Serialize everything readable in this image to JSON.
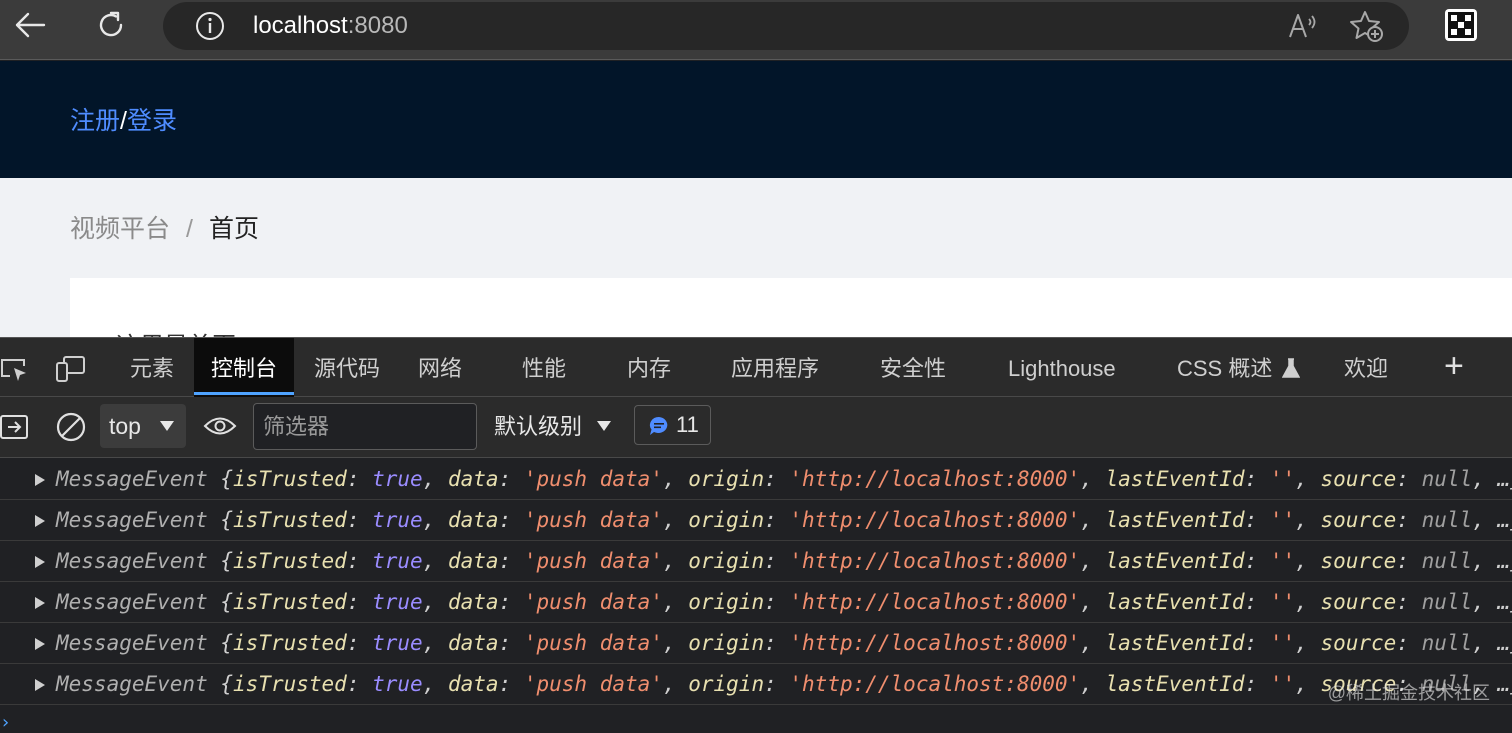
{
  "browser": {
    "url_host": "localhost",
    "url_port": ":8080"
  },
  "page": {
    "header": {
      "register_link": "注册",
      "separator": "/",
      "login_link": "登录"
    },
    "breadcrumb": [
      {
        "label": "视频平台"
      },
      {
        "label": "/"
      },
      {
        "label": "首页"
      }
    ],
    "card_text": "这里是首页"
  },
  "devtools": {
    "tabs": [
      {
        "label": "元素"
      },
      {
        "label": "控制台"
      },
      {
        "label": "源代码"
      },
      {
        "label": "网络"
      },
      {
        "label": "性能"
      },
      {
        "label": "内存"
      },
      {
        "label": "应用程序"
      },
      {
        "label": "安全性"
      },
      {
        "label": "Lighthouse"
      },
      {
        "label": "CSS 概述"
      },
      {
        "label": "欢迎"
      }
    ],
    "active_tab": "控制台",
    "add_tab_label": "+",
    "toolbar": {
      "context": "top",
      "filter_placeholder": "筛选器",
      "level": "默认级别",
      "issue_count": "11"
    },
    "log_entries": [
      {
        "type": "MessageEvent",
        "isTrusted": "true",
        "data": "'push data'",
        "origin": "'http://localhost:8000'",
        "lastEventId": "''",
        "source": "null",
        "more": "…}"
      },
      {
        "type": "MessageEvent",
        "isTrusted": "true",
        "data": "'push data'",
        "origin": "'http://localhost:8000'",
        "lastEventId": "''",
        "source": "null",
        "more": "…}"
      },
      {
        "type": "MessageEvent",
        "isTrusted": "true",
        "data": "'push data'",
        "origin": "'http://localhost:8000'",
        "lastEventId": "''",
        "source": "null",
        "more": "…}"
      },
      {
        "type": "MessageEvent",
        "isTrusted": "true",
        "data": "'push data'",
        "origin": "'http://localhost:8000'",
        "lastEventId": "''",
        "source": "null",
        "more": "…}"
      },
      {
        "type": "MessageEvent",
        "isTrusted": "true",
        "data": "'push data'",
        "origin": "'http://localhost:8000'",
        "lastEventId": "''",
        "source": "null",
        "more": "…}"
      },
      {
        "type": "MessageEvent",
        "isTrusted": "true",
        "data": "'push data'",
        "origin": "'http://localhost:8000'",
        "lastEventId": "''",
        "source": "null",
        "more": "…}"
      }
    ],
    "prompt": "›"
  },
  "watermark": "@稀土掘金技术社区",
  "colors": {
    "accent": "#4fa3ff",
    "link": "#4f8cff",
    "header_bg": "#021529",
    "string_value": "#f08e6e",
    "boolean_value": "#9a8cff"
  },
  "icons": [
    "back-arrow-icon",
    "reload-icon",
    "info-icon",
    "read-aloud-icon",
    "favorite-add-icon",
    "extension-icon",
    "inspect-element-icon",
    "device-toolbar-icon",
    "flask-icon",
    "sidebar-toggle-icon",
    "clear-console-icon",
    "eye-icon",
    "message-icon",
    "triangle-right-icon"
  ]
}
